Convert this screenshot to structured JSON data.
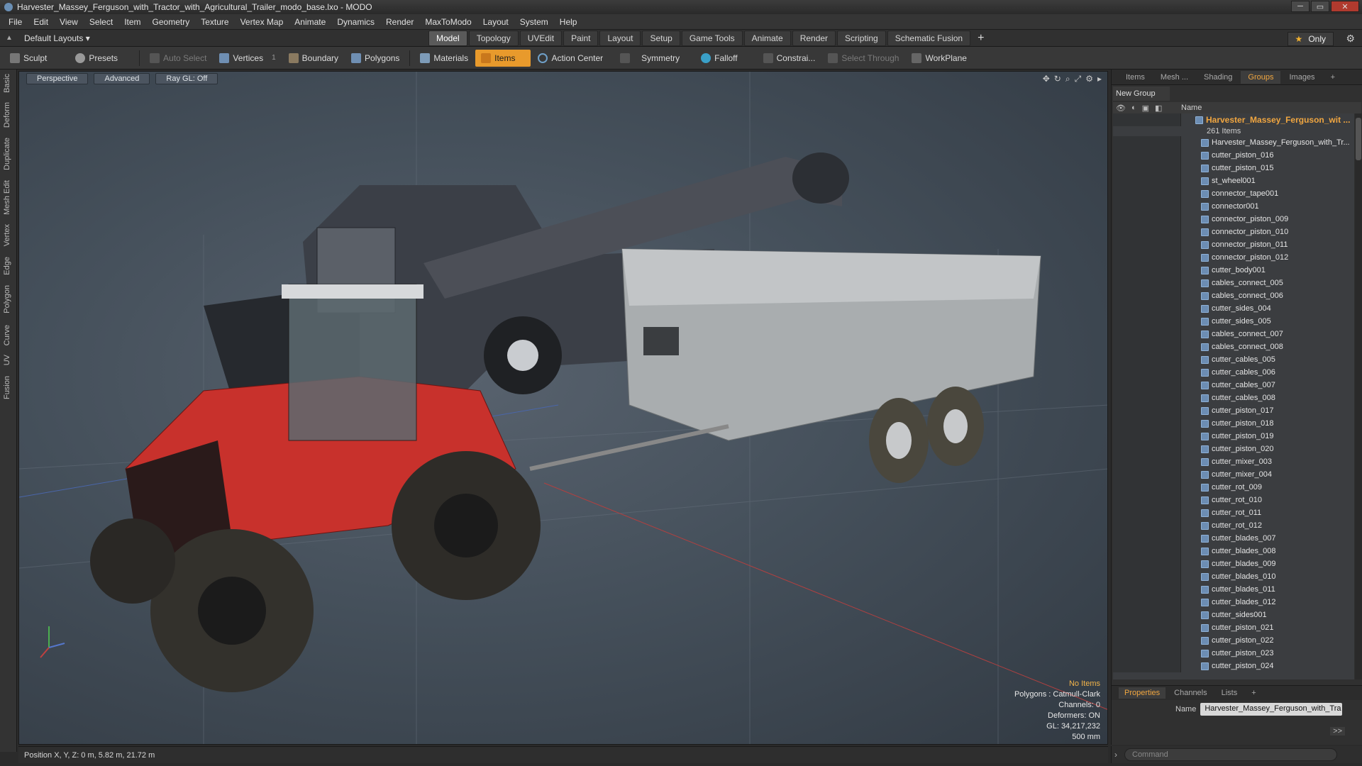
{
  "window": {
    "title": "Harvester_Massey_Ferguson_with_Tractor_with_Agricultural_Trailer_modo_base.lxo - MODO"
  },
  "menu": [
    "File",
    "Edit",
    "View",
    "Select",
    "Item",
    "Geometry",
    "Texture",
    "Vertex Map",
    "Animate",
    "Dynamics",
    "Render",
    "MaxToModo",
    "Layout",
    "System",
    "Help"
  ],
  "layout": {
    "selector": "Default Layouts ▾",
    "tabs": [
      "Model",
      "Topology",
      "UVEdit",
      "Paint",
      "Layout",
      "Setup",
      "Game Tools",
      "Animate",
      "Render",
      "Scripting",
      "Schematic Fusion"
    ],
    "active_tab": "Model",
    "only_label": "Only"
  },
  "toolbar": {
    "sculpt": "Sculpt",
    "presets": "Presets",
    "auto_select": "Auto Select",
    "vertices": "Vertices",
    "vertices_count": "1",
    "boundary": "Boundary",
    "polygons": "Polygons",
    "materials": "Materials",
    "items": "Items",
    "action_center": "Action Center",
    "symmetry": "Symmetry",
    "falloff": "Falloff",
    "constraints": "Constrai...",
    "select_through": "Select Through",
    "workplane": "WorkPlane"
  },
  "left_tabs": [
    "Basic",
    "Deform",
    "Duplicate",
    "Mesh Edit",
    "Vertex",
    "Edge",
    "Polygon",
    "Curve",
    "UV",
    "Fusion"
  ],
  "viewport": {
    "perspective": "Perspective",
    "advanced": "Advanced",
    "raygl": "Ray GL: Off",
    "info": {
      "no_items": "No Items",
      "polygons": "Polygons : Catmull-Clark",
      "channels": "Channels: 0",
      "deformers": "Deformers: ON",
      "gl": "GL: 34,217,232",
      "scale": "500 mm"
    }
  },
  "status": {
    "position": "Position X, Y, Z:   0 m, 5.82 m, 21.72 m"
  },
  "panel": {
    "tabs": [
      "Items",
      "Mesh ...",
      "Shading",
      "Groups",
      "Images"
    ],
    "active_tab": "Groups",
    "new_group": "New Group",
    "col_name": "Name",
    "group_name": "Harvester_Massey_Ferguson_wit ...",
    "group_count": "261 Items",
    "items": [
      "Harvester_Massey_Ferguson_with_Tr...",
      "cutter_piston_016",
      "cutter_piston_015",
      "st_wheel001",
      "connector_tape001",
      "connector001",
      "connector_piston_009",
      "connector_piston_010",
      "connector_piston_011",
      "connector_piston_012",
      "cutter_body001",
      "cables_connect_005",
      "cables_connect_006",
      "cutter_sides_004",
      "cutter_sides_005",
      "cables_connect_007",
      "cables_connect_008",
      "cutter_cables_005",
      "cutter_cables_006",
      "cutter_cables_007",
      "cutter_cables_008",
      "cutter_piston_017",
      "cutter_piston_018",
      "cutter_piston_019",
      "cutter_piston_020",
      "cutter_mixer_003",
      "cutter_mixer_004",
      "cutter_rot_009",
      "cutter_rot_010",
      "cutter_rot_011",
      "cutter_rot_012",
      "cutter_blades_007",
      "cutter_blades_008",
      "cutter_blades_009",
      "cutter_blades_010",
      "cutter_blades_011",
      "cutter_blades_012",
      "cutter_sides001",
      "cutter_piston_021",
      "cutter_piston_022",
      "cutter_piston_023",
      "cutter_piston_024"
    ]
  },
  "properties": {
    "tabs": [
      "Properties",
      "Channels",
      "Lists"
    ],
    "active_tab": "Properties",
    "name_label": "Name",
    "name_value": "Harvester_Massey_Ferguson_with_Tra",
    "expand": ">>"
  },
  "command": {
    "placeholder": "Command"
  },
  "colors": {
    "accent": "#e89a2c",
    "tractor_red": "#c8312c",
    "trailer_grey": "#a9adaf",
    "harvester_dark": "#3b3f47"
  }
}
